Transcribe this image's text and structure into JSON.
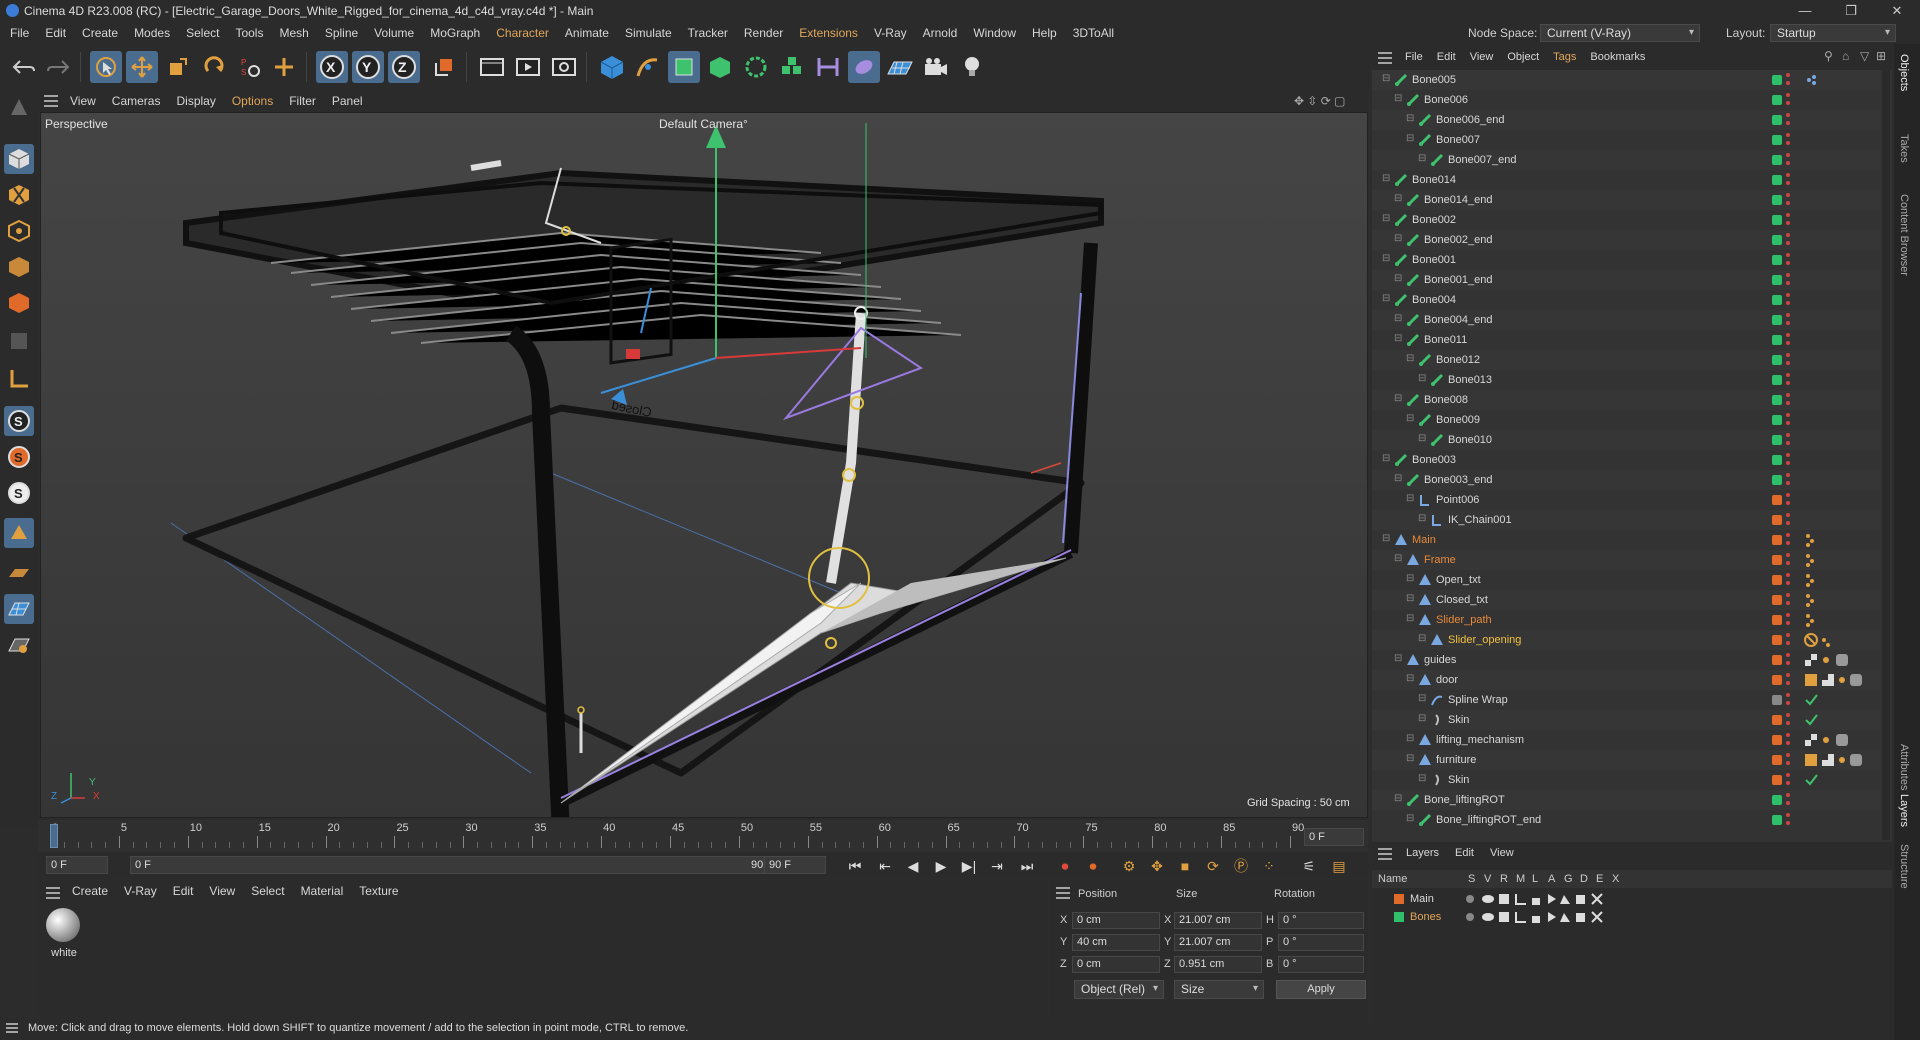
{
  "window": {
    "title": "Cinema 4D R23.008 (RC) - [Electric_Garage_Doors_White_Rigged_for_cinema_4d_c4d_vray.c4d *] - Main"
  },
  "menu": {
    "items": [
      "File",
      "Edit",
      "Create",
      "Modes",
      "Select",
      "Tools",
      "Mesh",
      "Spline",
      "Volume",
      "MoGraph",
      "Character",
      "Animate",
      "Simulate",
      "Tracker",
      "Render",
      "Extensions",
      "V-Ray",
      "Arnold",
      "Window",
      "Help",
      "3DToAll"
    ],
    "node_space_label": "Node Space:",
    "node_space_value": "Current (V-Ray)",
    "layout_label": "Layout:",
    "layout_value": "Startup"
  },
  "viewport": {
    "menu": [
      "View",
      "Cameras",
      "Display",
      "Options",
      "Filter",
      "Panel"
    ],
    "name": "Perspective",
    "camera": "Default Camera",
    "camera_suffix": "°",
    "grid_spacing": "Grid Spacing : 50 cm",
    "door_text": "Closed",
    "axis_labels": {
      "x": "X",
      "y": "Y",
      "z": "Z"
    }
  },
  "timeline": {
    "ticks": [
      "0",
      "5",
      "10",
      "15",
      "20",
      "25",
      "30",
      "35",
      "40",
      "45",
      "50",
      "55",
      "60",
      "65",
      "70",
      "75",
      "80",
      "85",
      "90"
    ],
    "current_frame": "0 F"
  },
  "transport": {
    "start": "0 F",
    "range_start": "0 F",
    "range_end": "90 F",
    "end": "90 F"
  },
  "materials": {
    "menu": [
      "Create",
      "V-Ray",
      "Edit",
      "View",
      "Select",
      "Material",
      "Texture"
    ],
    "items": [
      {
        "name": "white"
      }
    ]
  },
  "attributes": {
    "headers": {
      "position": "Position",
      "size": "Size",
      "rotation": "Rotation"
    },
    "rows": [
      {
        "axis": "X",
        "pos": "0 cm",
        "size_axis": "X",
        "size": "21.007 cm",
        "rot_axis": "H",
        "rot": "0 °"
      },
      {
        "axis": "Y",
        "pos": "40 cm",
        "size_axis": "Y",
        "size": "21.007 cm",
        "rot_axis": "P",
        "rot": "0 °"
      },
      {
        "axis": "Z",
        "pos": "0 cm",
        "size_axis": "Z",
        "size": "0.951 cm",
        "rot_axis": "B",
        "rot": "0 °"
      }
    ],
    "coord_mode": "Object (Rel)",
    "size_mode": "Size",
    "apply": "Apply"
  },
  "status": {
    "text": "Move: Click and drag to move elements. Hold down SHIFT to quantize movement / add to the selection in point mode, CTRL to remove."
  },
  "object_manager": {
    "menu": [
      "File",
      "Edit",
      "View",
      "Object",
      "Tags",
      "Bookmarks"
    ],
    "rows": [
      {
        "name": "Bone005",
        "depth": 1,
        "icon": "bone",
        "color": "#2fbf6a",
        "tags": "dots"
      },
      {
        "name": "Bone006",
        "depth": 2,
        "icon": "bone",
        "color": "#2fbf6a"
      },
      {
        "name": "Bone006_end",
        "depth": 3,
        "icon": "bone",
        "color": "#2fbf6a"
      },
      {
        "name": "Bone007",
        "depth": 3,
        "icon": "bone",
        "color": "#2fbf6a"
      },
      {
        "name": "Bone007_end",
        "depth": 4,
        "icon": "bone",
        "color": "#2fbf6a"
      },
      {
        "name": "Bone014",
        "depth": 1,
        "icon": "bone",
        "color": "#2fbf6a"
      },
      {
        "name": "Bone014_end",
        "depth": 2,
        "icon": "bone",
        "color": "#2fbf6a"
      },
      {
        "name": "Bone002",
        "depth": 1,
        "icon": "bone",
        "color": "#2fbf6a"
      },
      {
        "name": "Bone002_end",
        "depth": 2,
        "icon": "bone",
        "color": "#2fbf6a"
      },
      {
        "name": "Bone001",
        "depth": 1,
        "icon": "bone",
        "color": "#2fbf6a"
      },
      {
        "name": "Bone001_end",
        "depth": 2,
        "icon": "bone",
        "color": "#2fbf6a"
      },
      {
        "name": "Bone004",
        "depth": 1,
        "icon": "bone",
        "color": "#2fbf6a"
      },
      {
        "name": "Bone004_end",
        "depth": 2,
        "icon": "bone",
        "color": "#2fbf6a"
      },
      {
        "name": "Bone011",
        "depth": 2,
        "icon": "bone",
        "color": "#2fbf6a"
      },
      {
        "name": "Bone012",
        "depth": 3,
        "icon": "bone",
        "color": "#2fbf6a"
      },
      {
        "name": "Bone013",
        "depth": 4,
        "icon": "bone",
        "color": "#2fbf6a"
      },
      {
        "name": "Bone008",
        "depth": 2,
        "icon": "bone",
        "color": "#2fbf6a"
      },
      {
        "name": "Bone009",
        "depth": 3,
        "icon": "bone",
        "color": "#2fbf6a"
      },
      {
        "name": "Bone010",
        "depth": 4,
        "icon": "bone",
        "color": "#2fbf6a"
      },
      {
        "name": "Bone003",
        "depth": 1,
        "icon": "bone",
        "color": "#2fbf6a"
      },
      {
        "name": "Bone003_end",
        "depth": 2,
        "icon": "bone",
        "color": "#2fbf6a"
      },
      {
        "name": "Point006",
        "depth": 3,
        "icon": "null",
        "color": "#e06a2a"
      },
      {
        "name": "IK_Chain001",
        "depth": 4,
        "icon": "null",
        "color": "#e06a2a"
      },
      {
        "name": "Main",
        "depth": 1,
        "icon": "joint",
        "color": "#e06a2a",
        "highlight": "#e88a3a",
        "tags": "orange"
      },
      {
        "name": "Frame",
        "depth": 2,
        "icon": "joint",
        "color": "#e06a2a",
        "highlight": "#e88a3a",
        "tags": "orange"
      },
      {
        "name": "Open_txt",
        "depth": 3,
        "icon": "joint",
        "color": "#e06a2a",
        "tags": "orange"
      },
      {
        "name": "Closed_txt",
        "depth": 3,
        "icon": "joint",
        "color": "#e06a2a",
        "tags": "orange"
      },
      {
        "name": "Slider_path",
        "depth": 3,
        "icon": "joint",
        "color": "#e06a2a",
        "highlight": "#e88a3a",
        "tags": "orange"
      },
      {
        "name": "Slider_opening",
        "depth": 4,
        "icon": "joint",
        "color": "#e06a2a",
        "highlight": "#f0c040",
        "tags": "stop"
      },
      {
        "name": "guides",
        "depth": 2,
        "icon": "joint",
        "color": "#e06a2a",
        "tags": "mat"
      },
      {
        "name": "door",
        "depth": 3,
        "icon": "joint",
        "color": "#e06a2a",
        "tags": "mat2"
      },
      {
        "name": "Spline Wrap",
        "depth": 4,
        "icon": "wrap",
        "color": "#888888",
        "tags": "check"
      },
      {
        "name": "Skin",
        "depth": 4,
        "icon": "skin",
        "color": "#e06a2a",
        "tags": "check"
      },
      {
        "name": "lifting_mechanism",
        "depth": 3,
        "icon": "joint",
        "color": "#e06a2a",
        "tags": "mat"
      },
      {
        "name": "furniture",
        "depth": 3,
        "icon": "joint",
        "color": "#e06a2a",
        "tags": "mat2"
      },
      {
        "name": "Skin",
        "depth": 4,
        "icon": "skin",
        "color": "#e06a2a",
        "tags": "check"
      },
      {
        "name": "Bone_liftingROT",
        "depth": 2,
        "icon": "bone",
        "color": "#2fbf6a"
      },
      {
        "name": "Bone_liftingROT_end",
        "depth": 3,
        "icon": "bone",
        "color": "#2fbf6a"
      }
    ]
  },
  "layers": {
    "menu": [
      "Layers",
      "Edit",
      "View"
    ],
    "columns": [
      "Name",
      "S",
      "V",
      "R",
      "M",
      "L",
      "A",
      "G",
      "D",
      "E",
      "X"
    ],
    "items": [
      {
        "name": "Main",
        "color": "#e06a2a",
        "text_color": "#dddddd"
      },
      {
        "name": "Bones",
        "color": "#2fbf6a",
        "text_color": "#e0a65a"
      }
    ]
  },
  "side_tabs": [
    "Objects",
    "Takes",
    "Content Browser",
    "Attributes",
    "Layers",
    "Structure"
  ]
}
